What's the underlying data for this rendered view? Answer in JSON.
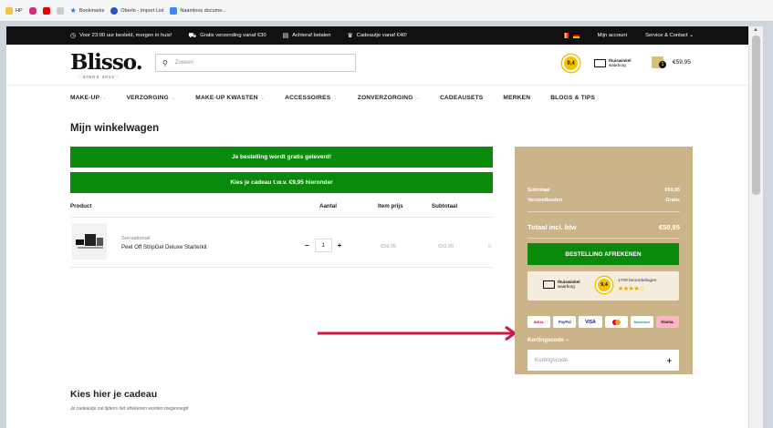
{
  "bookmarks": [
    {
      "label": "HP",
      "icon": "hp-folder-icon",
      "color": "#f4c542"
    },
    {
      "label": "",
      "icon": "instagram-icon",
      "color": "#d62976"
    },
    {
      "label": "",
      "icon": "youtube-icon",
      "color": "#e00000"
    },
    {
      "label": "",
      "icon": "gmail-icon",
      "color": "#cccccc"
    },
    {
      "label": "Bookmarks",
      "icon": "star-icon",
      "color": "#1a73e8"
    },
    {
      "label": "Oberlo - Import List",
      "icon": "oberlo-icon",
      "color": "#2255cc"
    },
    {
      "label": "Naamloos docume...",
      "icon": "docs-icon",
      "color": "#4285f4"
    }
  ],
  "topbar": {
    "items": [
      {
        "icon": "clock-icon",
        "text": "Voor 23:00 uur besteld, morgen in huis!"
      },
      {
        "icon": "truck-icon",
        "text": "Gratis verzending vanaf €30"
      },
      {
        "icon": "card-icon",
        "text": "Achteraf betalen"
      },
      {
        "icon": "gift-icon",
        "text": "Cadeautje vanaf €40!"
      }
    ],
    "account": "Mijn account",
    "service": "Service & Contact"
  },
  "header": {
    "logo": "Blisso.",
    "logo_sub": "- SINDS 2013 -",
    "search_placeholder": "Zoeken",
    "rating": "9,4",
    "thuiswinkel_line1": "thuiswinkel",
    "thuiswinkel_line2": "waarborg",
    "cart_count": "1",
    "cart_total": "€59,95"
  },
  "nav": [
    {
      "label": "MAKE-UP",
      "chev": true
    },
    {
      "label": "VERZORGING",
      "chev": true
    },
    {
      "label": "MAKE-UP KWASTEN",
      "chev": true
    },
    {
      "label": "ACCESSOIRES",
      "chev": true
    },
    {
      "label": "ZONVERZORGING",
      "chev": true
    },
    {
      "label": "CADEAUSETS",
      "chev": false
    },
    {
      "label": "MERKEN",
      "chev": false
    },
    {
      "label": "BLOGS & TIPS",
      "chev": false
    }
  ],
  "main": {
    "title": "Mijn winkelwagen",
    "banner_free": "Je bestelling wordt gratis geleverd!",
    "banner_gift": "Kies je cadeau t.w.v. €9,95 hieronder",
    "columns": {
      "product": "Product",
      "qty": "Aantal",
      "price": "Item prijs",
      "subtotal": "Subtotaal"
    },
    "product": {
      "brand": "Sensationail",
      "name": "Peel Off StripGel Deluxe Starterkit",
      "qty": "1",
      "price": "€59,95",
      "subtotal": "€59,95",
      "remove": "0"
    },
    "gift_title": "Kies hier je cadeau",
    "gift_note": "Je cadeautje zal tijdens het afrekenen worden toegevoegd"
  },
  "summary": {
    "subtotal_label": "Subtotaal",
    "subtotal_value": "€59,95",
    "shipping_label": "Verzendkosten",
    "shipping_value": "Gratis",
    "total_label": "Totaal incl. btw",
    "total_value": "€59,95",
    "checkout": "BESTELLING AFREKENEN",
    "review_rating": "9,4",
    "review_count": "1709 beoordelingen",
    "review_stars": "★★★★☆",
    "payments": [
      "iDEAL",
      "PayPal",
      "VISA",
      "Mastercard",
      "Bancontact",
      "Klarna."
    ],
    "discount_title": "Kortingscode",
    "discount_placeholder": "Kortingscode"
  },
  "colors": {
    "green": "#0a8a0a",
    "sidebar": "#cbb48a",
    "arrow": "#d01644"
  }
}
